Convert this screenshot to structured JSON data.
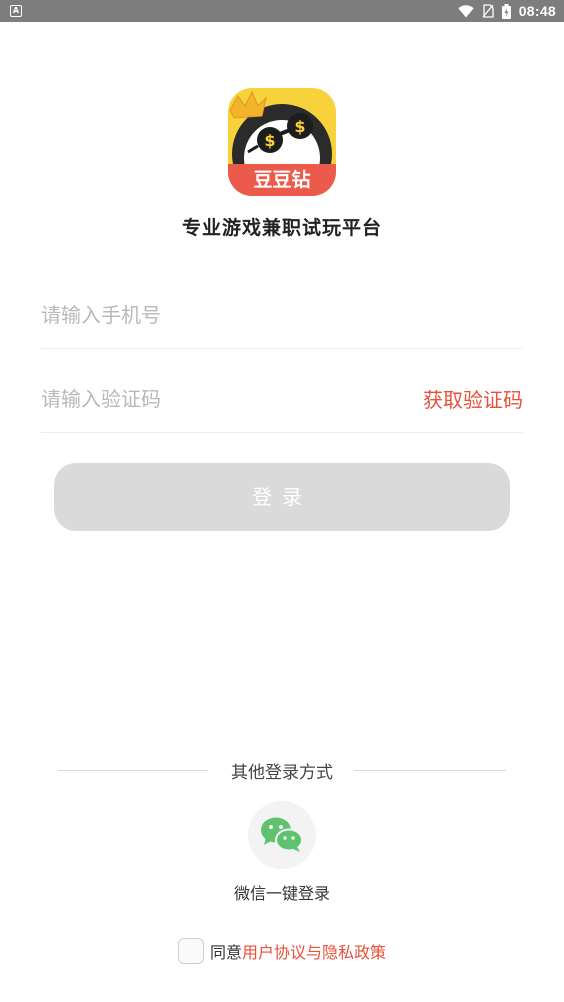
{
  "status_bar": {
    "time": "08:48",
    "notification_icon": "a-notification-icon",
    "wifi_icon": "wifi-icon",
    "sim_icon": "no-sim-icon",
    "battery_icon": "battery-charging-icon"
  },
  "brand": {
    "logo_text": "豆豆钻",
    "tagline": "专业游戏兼职试玩平台"
  },
  "form": {
    "phone_placeholder": "请输入手机号",
    "phone_value": "",
    "code_placeholder": "请输入验证码",
    "code_value": "",
    "get_code_label": "获取验证码",
    "login_label": "登录"
  },
  "other_login": {
    "title": "其他登录方式",
    "wechat_icon": "wechat-icon",
    "wechat_label": "微信一键登录"
  },
  "agreement": {
    "checked": false,
    "prefix": "同意",
    "link_text": "用户协议与隐私政策"
  },
  "colors": {
    "accent": "#e8503a",
    "button_disabled": "#dadada",
    "wechat_green": "#5ec26e",
    "logo_yellow": "#f7d23b",
    "logo_red": "#ec5a4c"
  }
}
